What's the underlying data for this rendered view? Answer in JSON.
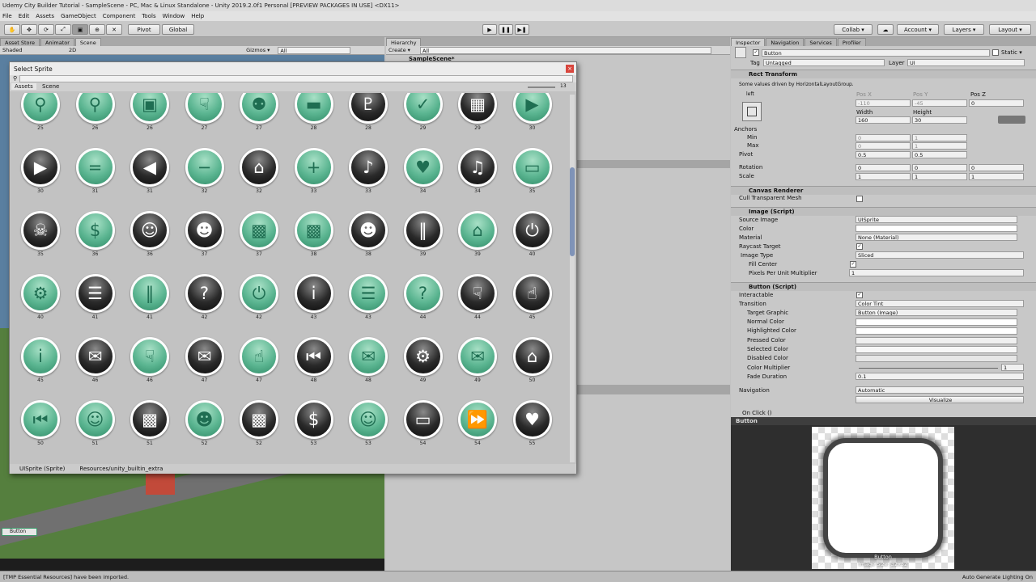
{
  "window": {
    "title": "Udemy City Builder Tutorial - SampleScene - PC, Mac & Linux Standalone - Unity 2019.2.0f1 Personal [PREVIEW PACKAGES IN USE] <DX11>"
  },
  "menu": [
    "File",
    "Edit",
    "Assets",
    "GameObject",
    "Component",
    "Tools",
    "Window",
    "Help"
  ],
  "toolbar": {
    "pivot": "Pivot",
    "global": "Global",
    "collab": "Collab ▾",
    "account": "Account ▾",
    "layers": "Layers ▾",
    "layout": "Layout ▾"
  },
  "scene": {
    "tabs": [
      "Asset Store",
      "Animator",
      "Scene"
    ],
    "shading": "Shaded",
    "mode2d": "2D",
    "gizmos": "Gizmos ▾",
    "search_placeholder": "All",
    "ui_button_label": "Button"
  },
  "hierarchy": {
    "tab": "Hierarchy",
    "create": "Create ▾",
    "search_placeholder": "All",
    "root": "SampleScene*"
  },
  "dialog": {
    "title": "Select Sprite",
    "close": "×",
    "search_placeholder": "",
    "tabs": [
      "Assets",
      "Scene"
    ],
    "zoom_count": "13",
    "footer_name": "UISprite (Sprite)",
    "footer_path": "Resources/unity_builtin_extra",
    "rows": [
      [
        {
          "n": "25",
          "c": "g",
          "i": "⚲"
        },
        {
          "n": "26",
          "c": "g",
          "i": "⚲"
        },
        {
          "n": "26",
          "c": "g",
          "i": "▣"
        },
        {
          "n": "27",
          "c": "g",
          "i": "☟"
        },
        {
          "n": "27",
          "c": "g",
          "i": "⚉"
        },
        {
          "n": "28",
          "c": "g",
          "i": "▬"
        },
        {
          "n": "28",
          "c": "b",
          "i": "♇"
        },
        {
          "n": "29",
          "c": "g",
          "i": "✓"
        },
        {
          "n": "29",
          "c": "b",
          "i": "▦"
        },
        {
          "n": "30",
          "c": "g",
          "i": "▶"
        }
      ],
      [
        {
          "n": "30",
          "c": "b",
          "i": "▶"
        },
        {
          "n": "31",
          "c": "g",
          "i": "="
        },
        {
          "n": "31",
          "c": "b",
          "i": "◀"
        },
        {
          "n": "32",
          "c": "g",
          "i": "−"
        },
        {
          "n": "32",
          "c": "b",
          "i": "⌂"
        },
        {
          "n": "33",
          "c": "g",
          "i": "+"
        },
        {
          "n": "33",
          "c": "b",
          "i": "♪"
        },
        {
          "n": "34",
          "c": "g",
          "i": "♥"
        },
        {
          "n": "34",
          "c": "b",
          "i": "♫"
        },
        {
          "n": "35",
          "c": "g",
          "i": "▭"
        }
      ],
      [
        {
          "n": "35",
          "c": "b",
          "i": "☠"
        },
        {
          "n": "36",
          "c": "g",
          "i": "$"
        },
        {
          "n": "36",
          "c": "b",
          "i": "☺"
        },
        {
          "n": "37",
          "c": "b",
          "i": "☻"
        },
        {
          "n": "37",
          "c": "g",
          "i": "▩"
        },
        {
          "n": "38",
          "c": "g",
          "i": "▩"
        },
        {
          "n": "38",
          "c": "b",
          "i": "☻"
        },
        {
          "n": "39",
          "c": "b",
          "i": "‖"
        },
        {
          "n": "39",
          "c": "g",
          "i": "⌂"
        },
        {
          "n": "40",
          "c": "b",
          "i": "⏻"
        }
      ],
      [
        {
          "n": "40",
          "c": "g",
          "i": "⚙"
        },
        {
          "n": "41",
          "c": "b",
          "i": "☰"
        },
        {
          "n": "41",
          "c": "g",
          "i": "‖"
        },
        {
          "n": "42",
          "c": "b",
          "i": "?"
        },
        {
          "n": "42",
          "c": "g",
          "i": "⏻"
        },
        {
          "n": "43",
          "c": "b",
          "i": "i"
        },
        {
          "n": "43",
          "c": "g",
          "i": "☰"
        },
        {
          "n": "44",
          "c": "g",
          "i": "?"
        },
        {
          "n": "44",
          "c": "b",
          "i": "☟"
        },
        {
          "n": "45",
          "c": "b",
          "i": "☝"
        }
      ],
      [
        {
          "n": "45",
          "c": "g",
          "i": "i"
        },
        {
          "n": "46",
          "c": "b",
          "i": "✉"
        },
        {
          "n": "46",
          "c": "g",
          "i": "☟"
        },
        {
          "n": "47",
          "c": "b",
          "i": "✉"
        },
        {
          "n": "47",
          "c": "g",
          "i": "☝"
        },
        {
          "n": "48",
          "c": "b",
          "i": "⏮"
        },
        {
          "n": "48",
          "c": "g",
          "i": "✉"
        },
        {
          "n": "49",
          "c": "b",
          "i": "⚙"
        },
        {
          "n": "49",
          "c": "g",
          "i": "✉"
        },
        {
          "n": "50",
          "c": "b",
          "i": "⌂"
        }
      ],
      [
        {
          "n": "50",
          "c": "g",
          "i": "⏮"
        },
        {
          "n": "51",
          "c": "g",
          "i": "☺"
        },
        {
          "n": "51",
          "c": "b",
          "i": "▩"
        },
        {
          "n": "52",
          "c": "g",
          "i": "☻"
        },
        {
          "n": "52",
          "c": "b",
          "i": "▩"
        },
        {
          "n": "53",
          "c": "b",
          "i": "$"
        },
        {
          "n": "53",
          "c": "g",
          "i": "☺"
        },
        {
          "n": "54",
          "c": "b",
          "i": "▭"
        },
        {
          "n": "54",
          "c": "g",
          "i": "⏩"
        },
        {
          "n": "55",
          "c": "b",
          "i": "♥"
        }
      ]
    ]
  },
  "inspector": {
    "tabs": [
      "Inspector",
      "Navigation",
      "Services",
      "Profiler"
    ],
    "object_name": "Button",
    "static_label": "Static ▾",
    "tag_label": "Tag",
    "tag_value": "Untagged",
    "layer_label": "Layer",
    "layer_value": "UI",
    "rect": {
      "title": "Rect Transform",
      "note": "Some values driven by HorizontalLayoutGroup.",
      "anchor": "left",
      "posx_label": "Pos X",
      "posy_label": "Pos Y",
      "posz_label": "Pos Z",
      "posx": "-110",
      "posy": "-45",
      "posz": "0",
      "width_label": "Width",
      "height_label": "Height",
      "width": "160",
      "height": "30",
      "anchors_label": "Anchors",
      "min_label": "Min",
      "max_label": "Max",
      "min_x": "0",
      "min_y": "1",
      "max_x": "0",
      "max_y": "1",
      "pivot_label": "Pivot",
      "pivot_x": "0.5",
      "pivot_y": "0.5",
      "rotation_label": "Rotation",
      "rot_x": "0",
      "rot_y": "0",
      "rot_z": "0",
      "scale_label": "Scale",
      "scale_x": "1",
      "scale_y": "1",
      "scale_z": "1"
    },
    "canvas_renderer": {
      "title": "Canvas Renderer",
      "cull": "Cull Transparent Mesh"
    },
    "image": {
      "title": "Image (Script)",
      "source_label": "Source Image",
      "source": "UISprite",
      "color_label": "Color",
      "material_label": "Material",
      "material": "None (Material)",
      "raycast_label": "Raycast Target",
      "type_label": "Image Type",
      "type": "Sliced",
      "fill_label": "Fill Center",
      "ppu_label": "Pixels Per Unit Multiplier",
      "ppu": "1"
    },
    "button": {
      "title": "Button (Script)",
      "interactable_label": "Interactable",
      "transition_label": "Transition",
      "transition": "Color Tint",
      "target_label": "Target Graphic",
      "target": "Button (Image)",
      "normal_label": "Normal Color",
      "highlighted_label": "Highlighted Color",
      "pressed_label": "Pressed Color",
      "selected_label": "Selected Color",
      "disabled_label": "Disabled Color",
      "multiplier_label": "Color Multiplier",
      "multiplier": "1",
      "fade_label": "Fade Duration",
      "fade": "0.1",
      "navigation_label": "Navigation",
      "navigation": "Automatic",
      "visualize": "Visualize",
      "onclick": "On Click ()"
    }
  },
  "preview": {
    "title": "Button",
    "caption": "Button",
    "size": "Image Size: 32x32"
  },
  "status": {
    "message": "[TMP Essential Resources] have been imported.",
    "right": "Auto Generate Lighting On"
  }
}
